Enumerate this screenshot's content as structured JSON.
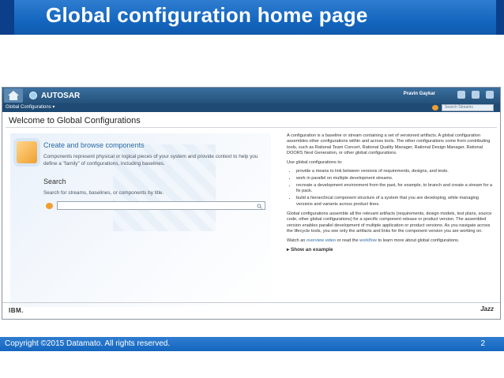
{
  "slide": {
    "title": "Global configuration home page",
    "copyright": "Copyright ©2015 Datamato. All rights reserved.",
    "page_number": "2"
  },
  "app": {
    "title": "AUTOSAR",
    "user": "Pravin Gaykar",
    "sub_label": "Global Configurations ▾",
    "stream_search_placeholder": "Search Streams"
  },
  "page": {
    "heading": "Welcome to Global Configurations",
    "create_title": "Create and browse components",
    "create_text": "Components represent physical or logical pieces of your system and provide context to help you define a \"family\" of configurations, including baselines.",
    "search_title": "Search",
    "search_text": "Search for streams, baselines, or components by title."
  },
  "info": {
    "p1": "A configuration is a baseline or stream containing a set of versioned artifacts. A global configuration assembles other configurations within and across tools. The other configurations come from contributing tools, such as Rational Team Concert, Rational Quality Manager, Rational Design Manager, Rational DOORS Next Generation, or other global configurations.",
    "p2": "Use global configurations to:",
    "bullets": [
      "provide a means to link between versions of requirements, designs, and tests.",
      "work in parallel on multiple development streams.",
      "recreate a development environment from the past, for example, to branch and create a stream for a fix pack.",
      "build a hierarchical component structure of a system that you are developing, while managing versions and variants across product lines."
    ],
    "p3": "Global configurations assemble all the relevant artifacts (requirements, design models, test plans, source code, other global configurations) for a specific component release or product version. The assembled version enables parallel development of multiple application or product versions. As you navigate across the lifecycle tools, you see only the artifacts and links for the component version you are working on.",
    "watch_prefix": "Watch an ",
    "overview_link": "overview video",
    "watch_mid": " or read the ",
    "workflow_link": "workflow",
    "watch_suffix": " to learn more about global configurations.",
    "show_example": "▸ Show an example"
  },
  "footer": {
    "ibm": "IBM.",
    "jazz": "Jazz"
  }
}
